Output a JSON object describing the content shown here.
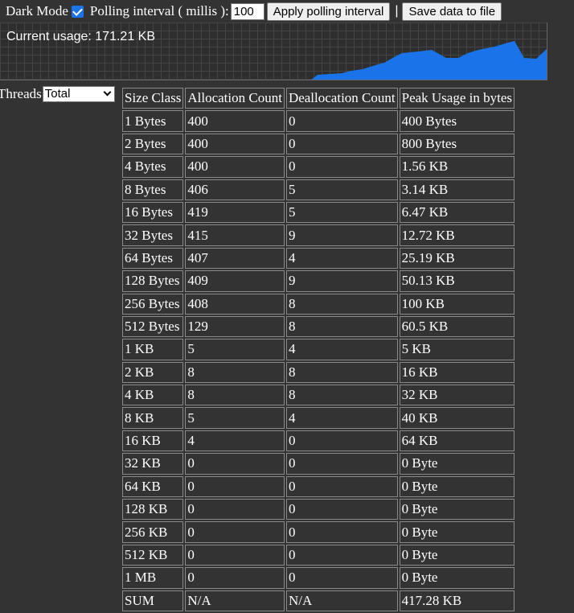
{
  "toolbar": {
    "dark_mode_label": "Dark Mode",
    "dark_mode_checked": true,
    "polling_label": "Polling interval ( millis ):",
    "polling_value": "100",
    "apply_button": "Apply polling interval",
    "separator": "|",
    "save_button": "Save data to file"
  },
  "graph": {
    "usage_text": "Current usage: 171.21 KB",
    "fill_color": "#1a73e8"
  },
  "threads": {
    "label": "Threads",
    "selected": "Total"
  },
  "table": {
    "headers": [
      "Size Class",
      "Allocation Count",
      "Deallocation Count",
      "Peak Usage in bytes"
    ],
    "rows": [
      [
        "1 Bytes",
        "400",
        "0",
        "400 Bytes"
      ],
      [
        "2 Bytes",
        "400",
        "0",
        "800 Bytes"
      ],
      [
        "4 Bytes",
        "400",
        "0",
        "1.56 KB"
      ],
      [
        "8 Bytes",
        "406",
        "5",
        "3.14 KB"
      ],
      [
        "16 Bytes",
        "419",
        "5",
        "6.47 KB"
      ],
      [
        "32 Bytes",
        "415",
        "9",
        "12.72 KB"
      ],
      [
        "64 Bytes",
        "407",
        "4",
        "25.19 KB"
      ],
      [
        "128 Bytes",
        "409",
        "9",
        "50.13 KB"
      ],
      [
        "256 Bytes",
        "408",
        "8",
        "100 KB"
      ],
      [
        "512 Bytes",
        "129",
        "8",
        "60.5 KB"
      ],
      [
        "1 KB",
        "5",
        "4",
        "5 KB"
      ],
      [
        "2 KB",
        "8",
        "8",
        "16 KB"
      ],
      [
        "4 KB",
        "8",
        "8",
        "32 KB"
      ],
      [
        "8 KB",
        "5",
        "4",
        "40 KB"
      ],
      [
        "16 KB",
        "4",
        "0",
        "64 KB"
      ],
      [
        "32 KB",
        "0",
        "0",
        "0 Byte"
      ],
      [
        "64 KB",
        "0",
        "0",
        "0 Byte"
      ],
      [
        "128 KB",
        "0",
        "0",
        "0 Byte"
      ],
      [
        "256 KB",
        "0",
        "0",
        "0 Byte"
      ],
      [
        "512 KB",
        "0",
        "0",
        "0 Byte"
      ],
      [
        "1 MB",
        "0",
        "0",
        "0 Byte"
      ],
      [
        "SUM",
        "N/A",
        "N/A",
        "417.28 KB"
      ]
    ]
  }
}
